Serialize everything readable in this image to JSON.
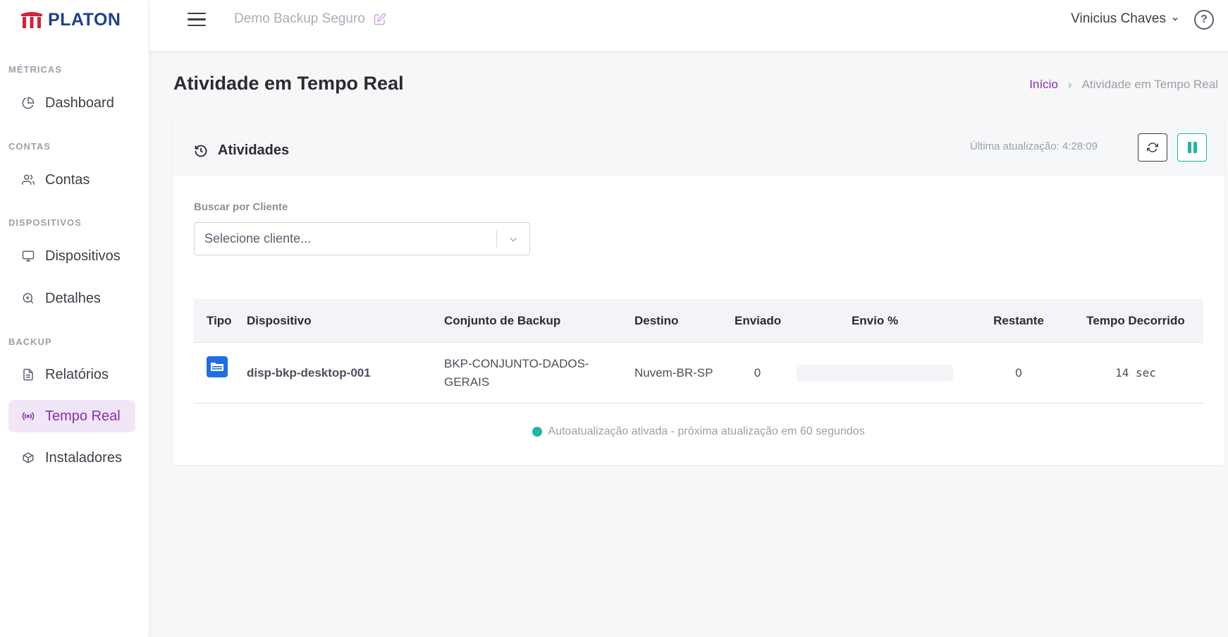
{
  "brand": {
    "name": "PLATON",
    "color": "#1f3f8f",
    "logo_color": "#d5213a"
  },
  "sidebar": {
    "sections": [
      {
        "label": "MÉTRICAS"
      },
      {
        "label": "CONTAS"
      },
      {
        "label": "DISPOSITIVOS"
      },
      {
        "label": "BACKUP"
      }
    ],
    "items": [
      {
        "label": "Dashboard",
        "icon": "pie-chart-icon"
      },
      {
        "label": "Contas",
        "icon": "users-icon"
      },
      {
        "label": "Dispositivos",
        "icon": "monitor-icon"
      },
      {
        "label": "Detalhes",
        "icon": "zoom-in-icon"
      },
      {
        "label": "Relatórios",
        "icon": "file-text-icon"
      },
      {
        "label": "Tempo Real",
        "icon": "broadcast-icon",
        "active": true
      },
      {
        "label": "Instaladores",
        "icon": "package-icon"
      }
    ]
  },
  "topbar": {
    "workspace": "Demo Backup Seguro",
    "user": "Vinicius Chaves",
    "help_label": "?"
  },
  "page": {
    "title": "Atividade em Tempo Real",
    "breadcrumb": {
      "home": "Início",
      "separator": "›",
      "current": "Atividade em Tempo Real"
    }
  },
  "card": {
    "title": "Atividades",
    "last_update": "Última atualização: 4:28:09 PM",
    "filter": {
      "label": "Buscar por Cliente",
      "placeholder": "Selecione cliente..."
    },
    "table": {
      "columns": [
        "Tipo",
        "Dispositivo",
        "Conjunto de Backup",
        "Destino",
        "Enviado",
        "Envio %",
        "Restante",
        "Tempo Decorrido"
      ],
      "rows": [
        {
          "type_icon": "folder-icon",
          "dispositivo": "disp-bkp-desktop-001",
          "conjunto": "BKP-CONJUNTO-DADOS-GERAIS",
          "destino": "Nuvem-BR-SP",
          "enviado": "0",
          "envio_pct": 0,
          "restante": "0",
          "tempo": "14 sec"
        }
      ]
    },
    "status": "Autoatualização ativada - próxima atualização em 60 segundos"
  },
  "colors": {
    "accent": "#8a2cb3",
    "teal": "#1fb7a0",
    "primary_blue": "#1f6fe5"
  }
}
